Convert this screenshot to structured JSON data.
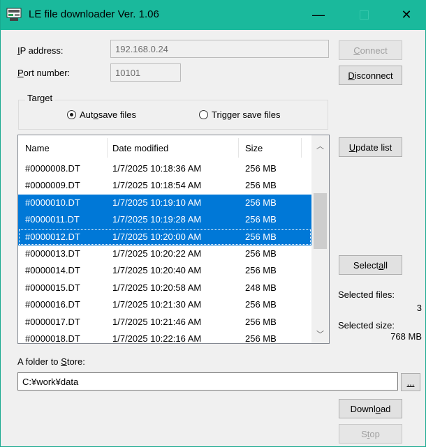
{
  "window": {
    "title": "LE file downloader Ver. 1.06",
    "minimize_glyph": "—",
    "close_glyph": "✕",
    "accent_color": "#1ab99c",
    "selection_color": "#0078d7"
  },
  "connection": {
    "ip_label_first": "I",
    "ip_label_rest": "P address:",
    "ip_value": "192.168.0.24",
    "port_label_first": "P",
    "port_label_rest": "ort number:",
    "port_value": "10101",
    "connect_first": "C",
    "connect_rest": "onnect",
    "disconnect_first": "D",
    "disconnect_rest": "isconnect"
  },
  "target": {
    "legend": "Target",
    "auto_a": "Aut",
    "auto_u": "o",
    "auto_b": " save files",
    "trigger_a": "Tri",
    "trigger_u": "g",
    "trigger_b": "ger save files",
    "selected": "auto"
  },
  "list": {
    "columns": [
      "Name",
      "Date modified",
      "Size"
    ],
    "rows": [
      {
        "name": "#0000008.DT",
        "date": "1/7/2025 10:18:36 AM",
        "size": "256 MB",
        "selected": false,
        "focused": false
      },
      {
        "name": "#0000009.DT",
        "date": "1/7/2025 10:18:54 AM",
        "size": "256 MB",
        "selected": false,
        "focused": false
      },
      {
        "name": "#0000010.DT",
        "date": "1/7/2025 10:19:10 AM",
        "size": "256 MB",
        "selected": true,
        "focused": false
      },
      {
        "name": "#0000011.DT",
        "date": "1/7/2025 10:19:28 AM",
        "size": "256 MB",
        "selected": true,
        "focused": false
      },
      {
        "name": "#0000012.DT",
        "date": "1/7/2025 10:20:00 AM",
        "size": "256 MB",
        "selected": true,
        "focused": true
      },
      {
        "name": "#0000013.DT",
        "date": "1/7/2025 10:20:22 AM",
        "size": "256 MB",
        "selected": false,
        "focused": false
      },
      {
        "name": "#0000014.DT",
        "date": "1/7/2025 10:20:40 AM",
        "size": "256 MB",
        "selected": false,
        "focused": false
      },
      {
        "name": "#0000015.DT",
        "date": "1/7/2025 10:20:58 AM",
        "size": "248 MB",
        "selected": false,
        "focused": false
      },
      {
        "name": "#0000016.DT",
        "date": "1/7/2025 10:21:30 AM",
        "size": "256 MB",
        "selected": false,
        "focused": false
      },
      {
        "name": "#0000017.DT",
        "date": "1/7/2025 10:21:46 AM",
        "size": "256 MB",
        "selected": false,
        "focused": false
      },
      {
        "name": "#0000018.DT",
        "date": "1/7/2025 10:22:16 AM",
        "size": "256 MB",
        "selected": false,
        "focused": false
      }
    ],
    "scroll_up_glyph": "︿",
    "scroll_down_glyph": "﹀"
  },
  "side": {
    "update_first": "U",
    "update_rest": "pdate list",
    "selectall_a": "Select ",
    "selectall_u": "a",
    "selectall_b": "ll",
    "selected_files_label": "Selected files:",
    "selected_files_value": "3",
    "selected_size_label": "Selected size:",
    "selected_size_value": "768 MB"
  },
  "store": {
    "label_a": "A folder to ",
    "label_u": "S",
    "label_b": "tore:",
    "path": "C:¥work¥data",
    "browse": "..."
  },
  "actions": {
    "download_a": "Downl",
    "download_u": "o",
    "download_b": "ad",
    "stop_a": "S",
    "stop_u": "t",
    "stop_b": "op"
  }
}
